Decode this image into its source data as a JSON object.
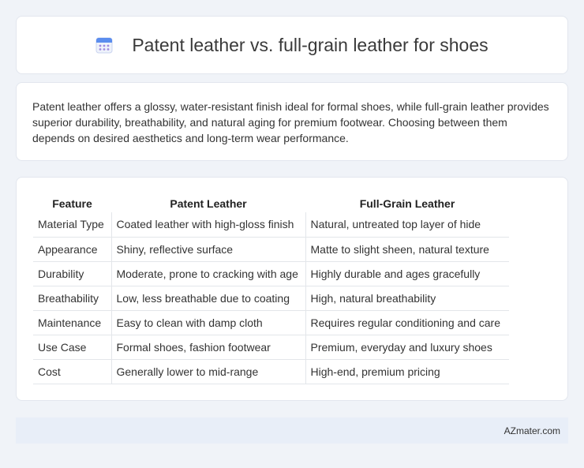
{
  "header": {
    "icon": "calendar-icon",
    "title": "Patent leather vs. full-grain leather for shoes"
  },
  "description": "Patent leather offers a glossy, water-resistant finish ideal for formal shoes, while full-grain leather provides superior durability, breathability, and natural aging for premium footwear. Choosing between them depends on desired aesthetics and long-term wear performance.",
  "table": {
    "headers": [
      "Feature",
      "Patent Leather",
      "Full-Grain Leather"
    ],
    "rows": [
      [
        "Material Type",
        "Coated leather with high-gloss finish",
        "Natural, untreated top layer of hide"
      ],
      [
        "Appearance",
        "Shiny, reflective surface",
        "Matte to slight sheen, natural texture"
      ],
      [
        "Durability",
        "Moderate, prone to cracking with age",
        "Highly durable and ages gracefully"
      ],
      [
        "Breathability",
        "Low, less breathable due to coating",
        "High, natural breathability"
      ],
      [
        "Maintenance",
        "Easy to clean with damp cloth",
        "Requires regular conditioning and care"
      ],
      [
        "Use Case",
        "Formal shoes, fashion footwear",
        "Premium, everyday and luxury shoes"
      ],
      [
        "Cost",
        "Generally lower to mid-range",
        "High-end, premium pricing"
      ]
    ]
  },
  "footer": {
    "site": "AZmater.com"
  },
  "colors": {
    "background": "#f0f3f8",
    "footer_bg": "#e8eef8",
    "icon_blue": "#5b8dee",
    "icon_purple": "#a08be0"
  }
}
